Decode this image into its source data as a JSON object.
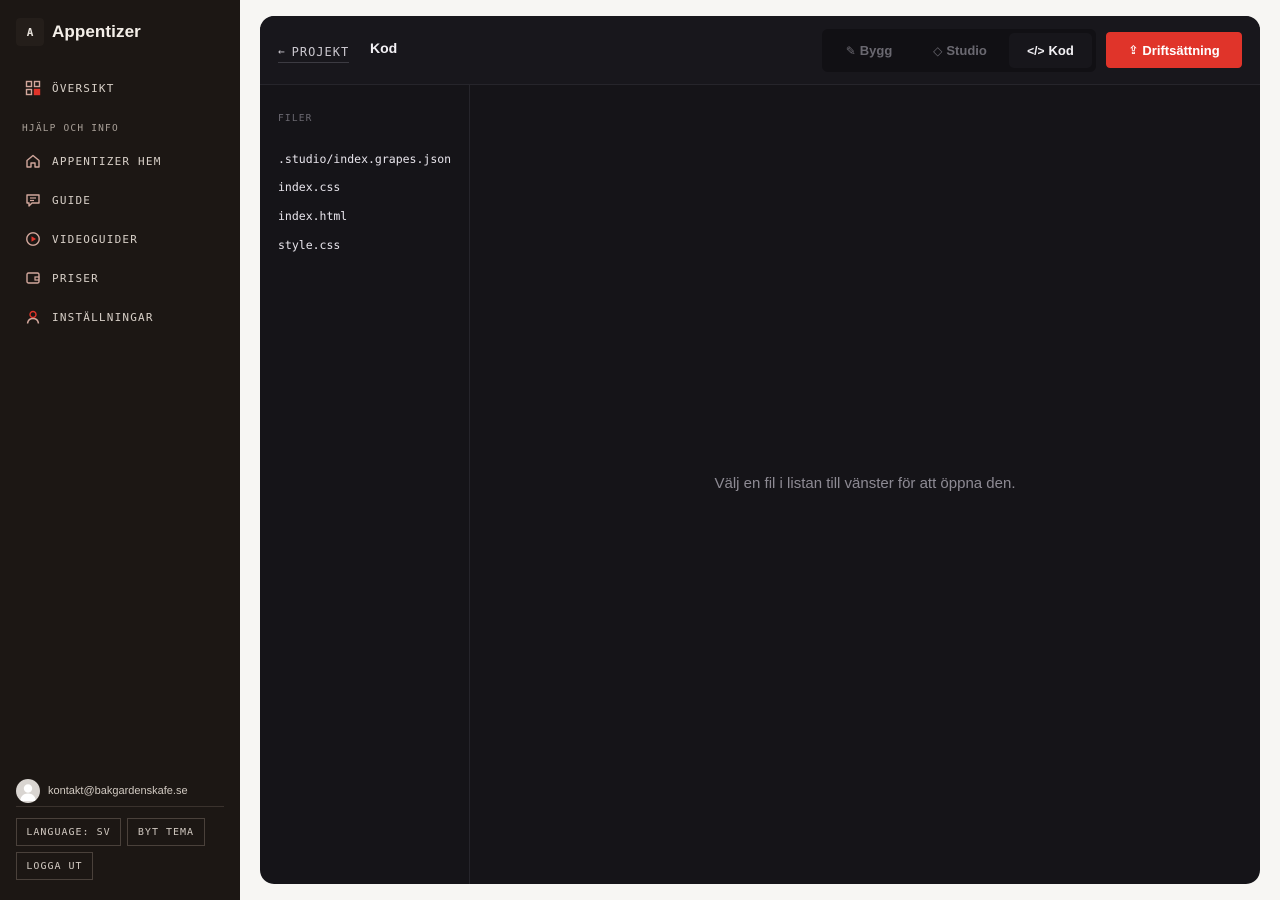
{
  "app": {
    "logo_letter": "A",
    "name": "Appentizer"
  },
  "nav": {
    "overview": {
      "label": "ÖVERSIKT",
      "icon": "grid-icon"
    },
    "section_label": "HJÄLP OCH INFO",
    "items": [
      {
        "label": "APPENTIZER HEM",
        "icon": "home-icon"
      },
      {
        "label": "GUIDE",
        "icon": "chat-icon"
      },
      {
        "label": "VIDEOGUIDER",
        "icon": "play-circle-icon"
      },
      {
        "label": "PRISER",
        "icon": "wallet-icon"
      },
      {
        "label": "INSTÄLLNINGAR",
        "icon": "user-icon"
      }
    ]
  },
  "user": {
    "email": "kontakt@bakgardenskafe.se"
  },
  "footer": {
    "language_label": "LANGUAGE: SV",
    "theme_label": "BYT TEMA",
    "logout_label": "LOGGA UT"
  },
  "topbar": {
    "back_label": "PROJEKT",
    "title": "Kod",
    "modes": [
      {
        "glyph": "✎",
        "label": "Bygg",
        "active": false
      },
      {
        "glyph": "◇",
        "label": "Studio",
        "active": false
      },
      {
        "glyph": "</>",
        "label": "Kod",
        "active": true
      }
    ],
    "deploy": {
      "glyph": "⇪",
      "label": "Driftsättning"
    }
  },
  "files": {
    "header": "FILER",
    "items": [
      ".studio/index.grapes.json",
      "index.css",
      "index.html",
      "style.css"
    ]
  },
  "editor": {
    "empty_message": "Välj en fil i listan till vänster för att öppna den."
  },
  "colors": {
    "accent": "#e0342a",
    "sidebar_bg": "#1c1714",
    "panel_bg": "#151418",
    "page_bg": "#f7f6f3"
  }
}
